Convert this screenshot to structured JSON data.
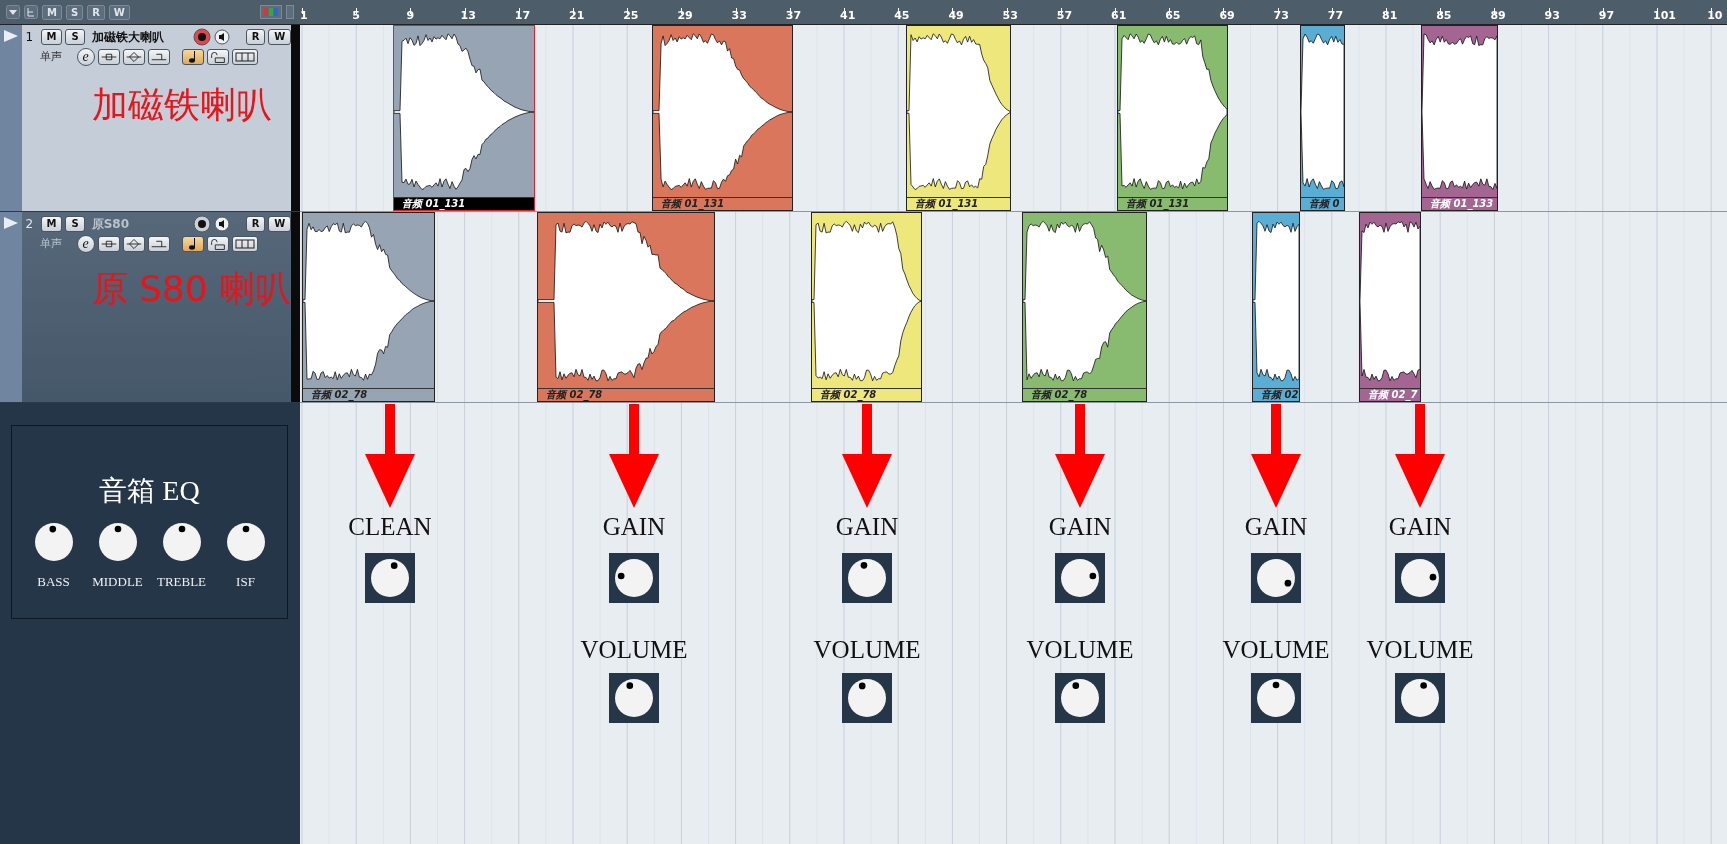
{
  "toolbar": {
    "buttons": [
      "M",
      "S",
      "R",
      "W"
    ]
  },
  "ruler": {
    "labels": [
      "1",
      "5",
      "9",
      "13",
      "17",
      "21",
      "25",
      "29",
      "33",
      "37",
      "41",
      "45",
      "49",
      "53",
      "57",
      "61",
      "65",
      "69",
      "73",
      "77",
      "81",
      "85",
      "89",
      "93",
      "97",
      "101",
      "10"
    ]
  },
  "tracks": [
    {
      "number": "1",
      "name": "加磁铁大喇叭",
      "mode": "单声",
      "selected": true,
      "record_armed": true,
      "annotation": "加磁铁喇叭",
      "mute": "M",
      "solo": "S",
      "read": "R",
      "write": "W",
      "edit": "e",
      "clips": [
        {
          "label": "音频 01_131",
          "color": "#97a4b3",
          "selected": true
        },
        {
          "label": "音频 01_131",
          "color": "#d9765b",
          "selected": false
        },
        {
          "label": "音频 01_131",
          "color": "#ede77c",
          "selected": false
        },
        {
          "label": "音频 01_131",
          "color": "#88bb70",
          "selected": false
        },
        {
          "label": "音频 0",
          "color": "#5aaed6",
          "selected": false
        },
        {
          "label": "音频 01_133",
          "color": "#a46592",
          "selected": false
        }
      ]
    },
    {
      "number": "2",
      "name": "原S80",
      "mode": "单声",
      "selected": false,
      "record_armed": false,
      "annotation": "原 S80 喇叭",
      "mute": "M",
      "solo": "S",
      "read": "R",
      "write": "W",
      "edit": "e",
      "clips": [
        {
          "label": "音频 02_78",
          "color": "#97a4b3",
          "selected": false
        },
        {
          "label": "音频 02_78",
          "color": "#d9765b",
          "selected": false
        },
        {
          "label": "音频 02_78",
          "color": "#ede77c",
          "selected": false
        },
        {
          "label": "音频 02_78",
          "color": "#88bb70",
          "selected": false
        },
        {
          "label": "音频 02",
          "color": "#5aaed6",
          "selected": false
        },
        {
          "label": "音频 02_7",
          "color": "#a46592",
          "selected": false
        }
      ]
    }
  ],
  "eq_panel": {
    "title": "音箱 EQ",
    "knobs": [
      {
        "label": "BASS"
      },
      {
        "label": "MIDDLE"
      },
      {
        "label": "TREBLE"
      },
      {
        "label": "ISF"
      }
    ]
  },
  "annotations": [
    {
      "controls": [
        {
          "label": "CLEAN"
        }
      ]
    },
    {
      "controls": [
        {
          "label": "GAIN"
        },
        {
          "label": "VOLUME"
        }
      ]
    },
    {
      "controls": [
        {
          "label": "GAIN"
        },
        {
          "label": "VOLUME"
        }
      ]
    },
    {
      "controls": [
        {
          "label": "GAIN"
        },
        {
          "label": "VOLUME"
        }
      ]
    },
    {
      "controls": [
        {
          "label": "GAIN"
        },
        {
          "label": "VOLUME"
        }
      ]
    },
    {
      "controls": [
        {
          "label": "GAIN"
        },
        {
          "label": "VOLUME"
        }
      ]
    }
  ]
}
